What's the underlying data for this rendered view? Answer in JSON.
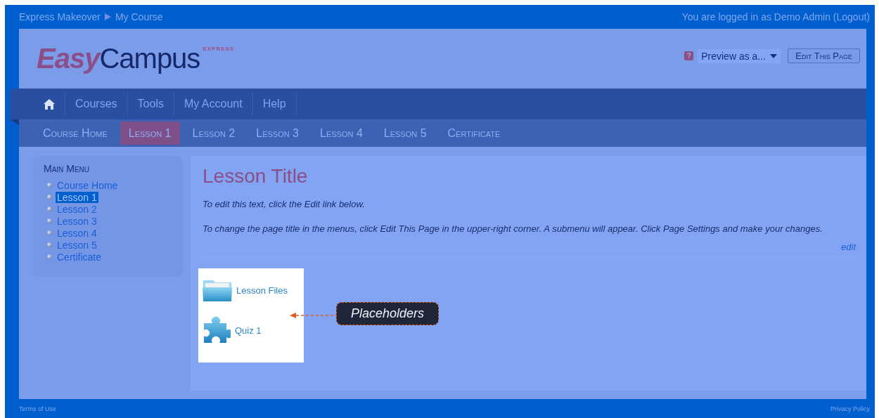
{
  "breadcrumb": [
    "Express Makeover",
    "My Course"
  ],
  "login_text": "You are logged in as Demo Admin (Logout)",
  "logo": {
    "part_1": "Easy",
    "part_2": "Campus",
    "tag": "EXPRESS"
  },
  "header": {
    "help": "?",
    "preview_select": "Preview as a...",
    "edit_button": "Edit This Page"
  },
  "main_nav": [
    "Courses",
    "Tools",
    "My Account",
    "Help"
  ],
  "sub_nav": [
    {
      "label": "Course Home",
      "selected": false
    },
    {
      "label": "Lesson 1",
      "selected": true
    },
    {
      "label": "Lesson 2",
      "selected": false
    },
    {
      "label": "Lesson 3",
      "selected": false
    },
    {
      "label": "Lesson 4",
      "selected": false
    },
    {
      "label": "Lesson 5",
      "selected": false
    },
    {
      "label": "Certificate",
      "selected": false
    }
  ],
  "sidebar": {
    "title": "Main Menu",
    "items": [
      {
        "label": "Course Home",
        "selected": false
      },
      {
        "label": "Lesson 1",
        "selected": true
      },
      {
        "label": "Lesson 2",
        "selected": false
      },
      {
        "label": "Lesson 3",
        "selected": false
      },
      {
        "label": "Lesson 4",
        "selected": false
      },
      {
        "label": "Lesson 5",
        "selected": false
      },
      {
        "label": "Certificate",
        "selected": false
      }
    ]
  },
  "content": {
    "title": "Lesson Title",
    "paragraphs": [
      "To edit this text, click the Edit link below.",
      "To change the page title in the menus, click Edit This Page in the upper-right corner. A submenu will appear. Click Page Settings and make your changes."
    ],
    "edit_link": "edit",
    "placeholders": [
      {
        "kind": "folder",
        "label": "Lesson Files"
      },
      {
        "kind": "puzzle",
        "label": "Quiz 1"
      }
    ],
    "callout": "Placeholders"
  },
  "footer": {
    "left": "Terms of Use",
    "right": "Privacy Policy"
  }
}
